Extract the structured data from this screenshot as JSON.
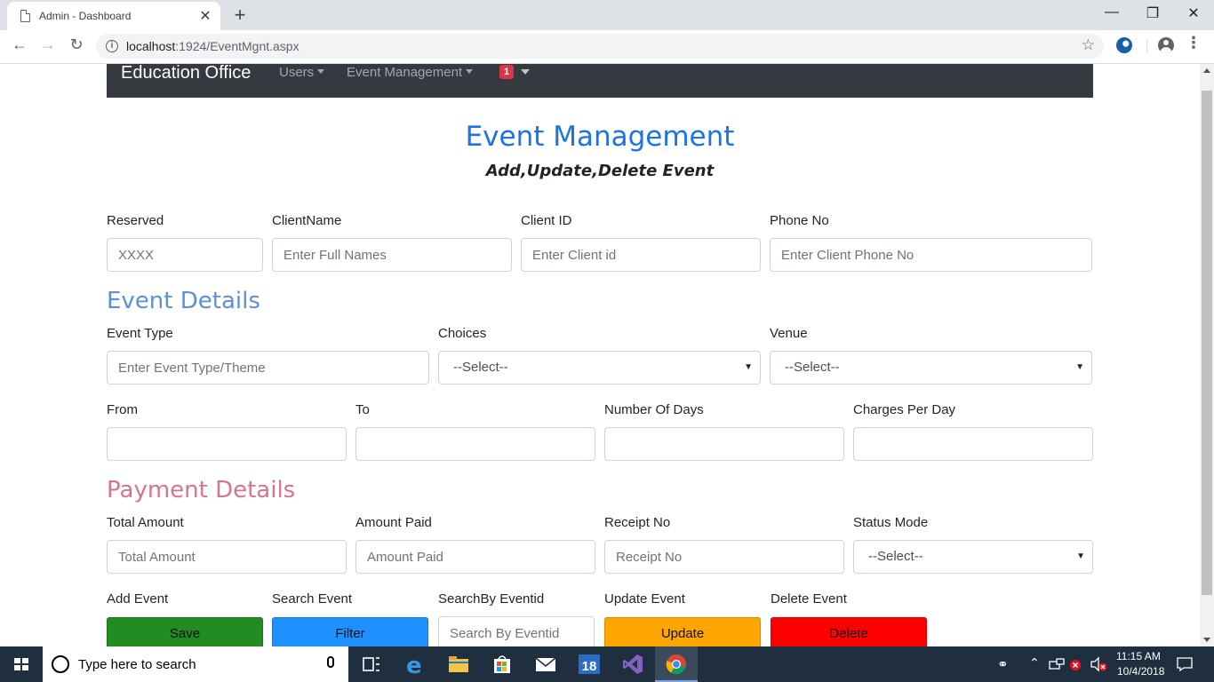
{
  "browser": {
    "tab_title": "Admin - Dashboard",
    "tab_close": "✕",
    "new_tab": "+",
    "minimize": "—",
    "restore": "❐",
    "close": "✕",
    "url_host": "localhost",
    "url_path": ":1924/EventMgnt.aspx"
  },
  "navbar": {
    "brand": "Education Office",
    "links": [
      "Users",
      "Event Management"
    ],
    "badge": "1"
  },
  "page": {
    "title": "Event Management",
    "subtitle": "Add,Update,Delete Event"
  },
  "client": {
    "reserved_label": "Reserved",
    "reserved_value": "XXXX",
    "client_name_label": "ClientName",
    "client_name_placeholder": "Enter Full Names",
    "client_id_label": "Client ID",
    "client_id_placeholder": "Enter Client id",
    "phone_label": "Phone No",
    "phone_placeholder": "Enter Client Phone No"
  },
  "event_details": {
    "heading": "Event Details",
    "heading_color": "#5b8fe0",
    "event_type_label": "Event Type",
    "event_type_placeholder": "Enter Event Type/Theme",
    "choices_label": "Choices",
    "choices_selected": "--Select--",
    "venue_label": "Venue",
    "venue_selected": "--Select--",
    "from_label": "From",
    "to_label": "To",
    "days_label": "Number Of Days",
    "charges_label": "Charges Per Day"
  },
  "payment_details": {
    "heading": "Payment Details",
    "heading_color": "#d6758f",
    "total_label": "Total Amount",
    "total_placeholder": "Total Amount",
    "paid_label": "Amount Paid",
    "paid_placeholder": "Amount Paid",
    "receipt_label": "Receipt No",
    "receipt_placeholder": "Receipt No",
    "status_label": "Status Mode",
    "status_selected": "--Select--"
  },
  "actions": {
    "add_label": "Add Event",
    "save_button": "Save",
    "search_label": "Search Event",
    "filter_button": "Filter",
    "searchby_label": "SearchBy Eventid",
    "searchby_placeholder": "Search By Eventid",
    "update_label": "Update Event",
    "update_button": "Update",
    "delete_label": "Delete Event",
    "delete_button": "Delete",
    "colors": {
      "save": "#228b22",
      "filter": "#1e90ff",
      "update": "#ffa500",
      "delete": "#ff0000"
    }
  },
  "taskbar": {
    "search_text": "Type here to search",
    "calendar_badge": "18",
    "time": "11:15 AM",
    "date": "10/4/2018"
  }
}
